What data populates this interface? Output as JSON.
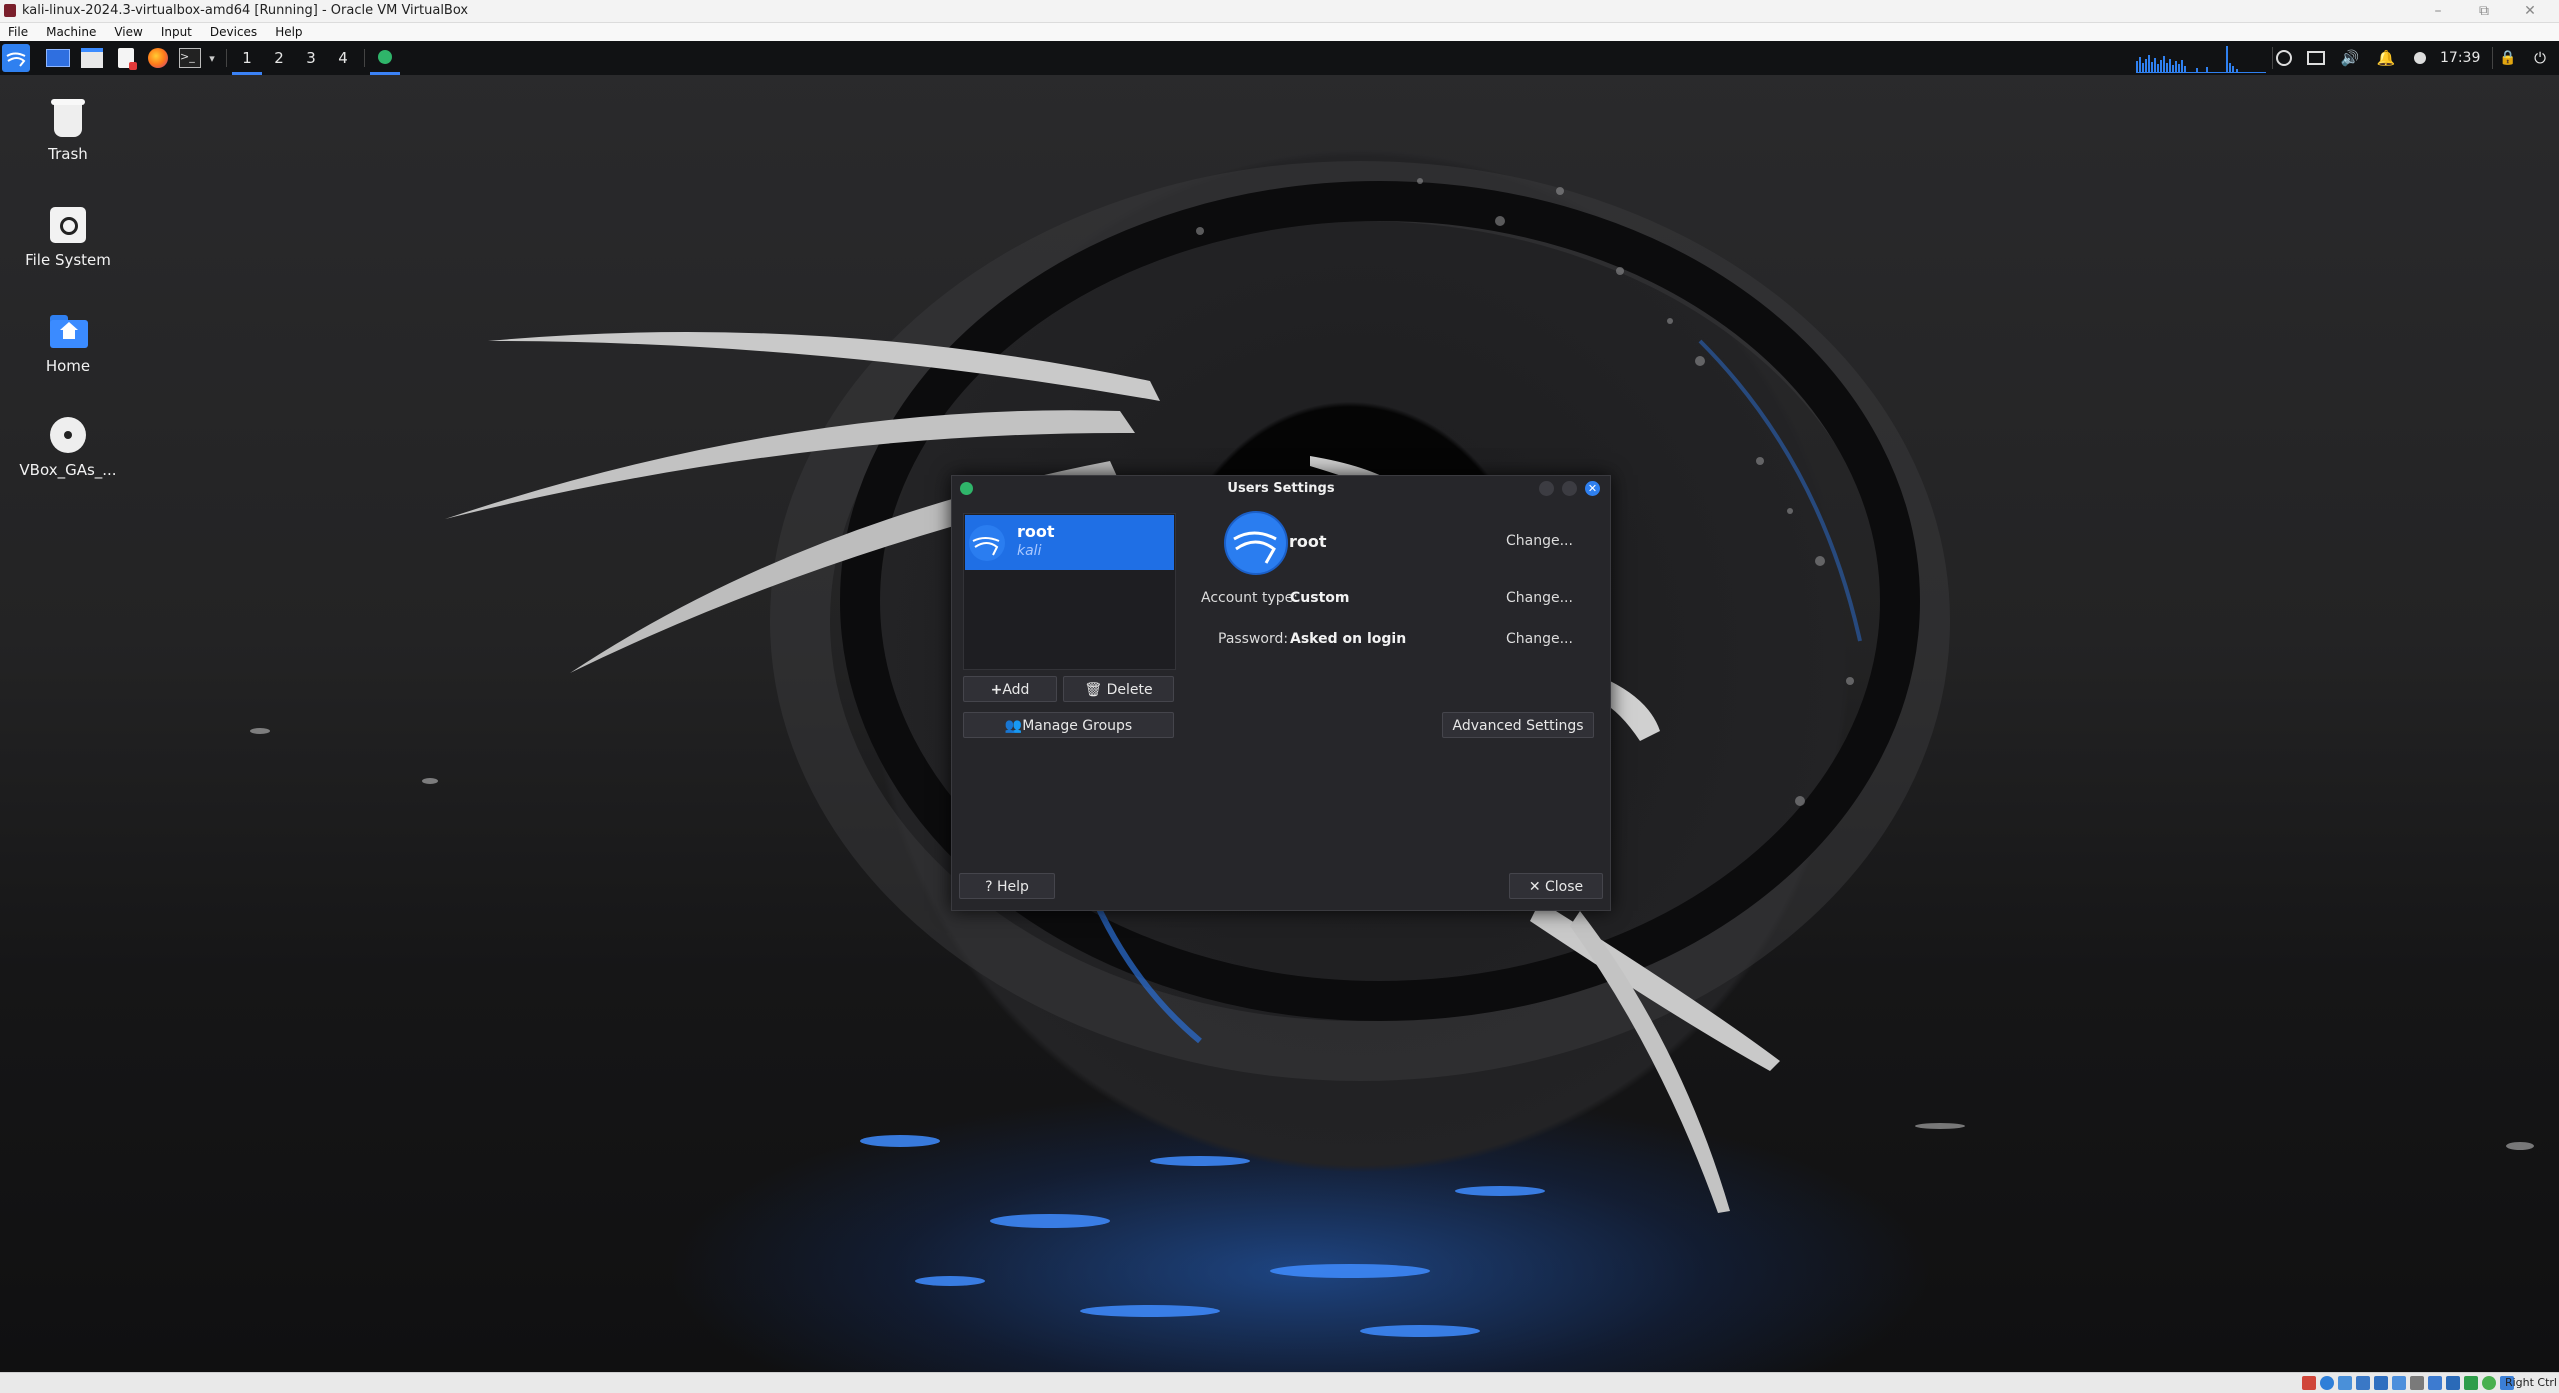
{
  "host": {
    "window_title": "kali-linux-2024.3-virtualbox-amd64 [Running] - Oracle VM VirtualBox",
    "menu": [
      "File",
      "Machine",
      "View",
      "Input",
      "Devices",
      "Help"
    ],
    "status_right": "Right Ctrl"
  },
  "panel": {
    "workspaces": [
      "1",
      "2",
      "3",
      "4"
    ],
    "active_workspace": "1",
    "clock": "17:39"
  },
  "desktop_icons": [
    {
      "label": "Trash",
      "icon": "trash-icon"
    },
    {
      "label": "File System",
      "icon": "drive-icon"
    },
    {
      "label": "Home",
      "icon": "home-folder-icon"
    },
    {
      "label": "VBox_GAs_...",
      "icon": "cd-icon"
    }
  ],
  "dialog": {
    "title": "Users Settings",
    "users": [
      {
        "name": "root",
        "subtitle": "kali"
      }
    ],
    "selected_user": "root",
    "buttons": {
      "add": "Add",
      "delete": "Delete",
      "manage_groups": "Manage Groups",
      "advanced_settings": "Advanced Settings",
      "help": "Help",
      "close": "Close"
    },
    "details": {
      "username": "root",
      "account_type_label": "Account type:",
      "account_type_value": "Custom",
      "password_label": "Password:",
      "password_value": "Asked on login",
      "change_label": "Change..."
    }
  },
  "colors": {
    "accent": "#1f6fe5",
    "dialog_bg": "#26262a",
    "panel_bg": "#111214"
  }
}
